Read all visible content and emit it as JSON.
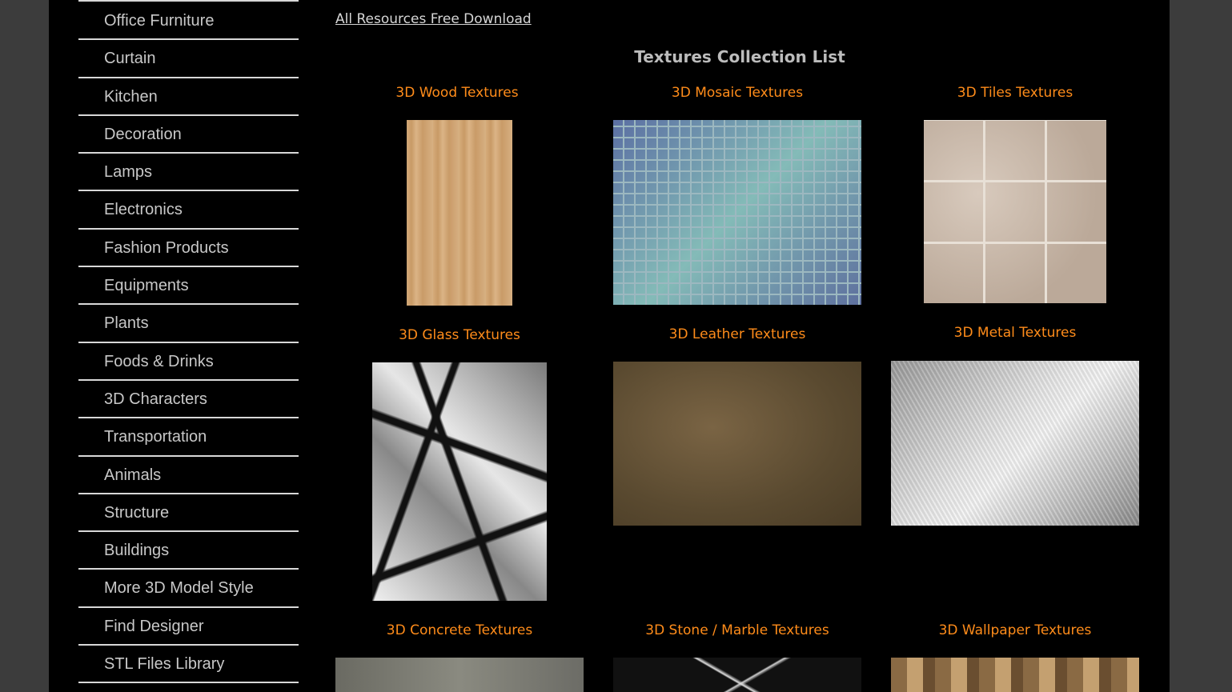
{
  "sidebar": {
    "items": [
      "Office Furniture",
      "Curtain",
      "Kitchen",
      "Decoration",
      "Lamps",
      "Electronics",
      "Fashion Products",
      "Equipments",
      "Plants",
      "Foods & Drinks",
      "3D Characters",
      "Transportation",
      "Animals",
      "Structure",
      "Buildings",
      "More 3D Model Style",
      "Find Designer",
      "STL Files Library"
    ]
  },
  "main": {
    "top_link": "All Resources Free Download",
    "heading": "Textures Collection List",
    "textures": [
      {
        "title": "3D Wood Textures",
        "texture": "wood"
      },
      {
        "title": "3D Mosaic Textures",
        "texture": "mosaic"
      },
      {
        "title": "3D Tiles Textures",
        "texture": "tiles"
      },
      {
        "title": "3D Glass Textures",
        "texture": "glass"
      },
      {
        "title": "3D Leather Textures",
        "texture": "leather"
      },
      {
        "title": "3D Metal Textures",
        "texture": "metal"
      },
      {
        "title": "3D Concrete Textures",
        "texture": "concrete"
      },
      {
        "title": "3D Stone / Marble Textures",
        "texture": "stone"
      },
      {
        "title": "3D Wallpaper Textures",
        "texture": "wallpaper"
      }
    ]
  },
  "colors": {
    "accent": "#ff8c1a",
    "background": "#000000",
    "outer": "#3c3c3c"
  }
}
